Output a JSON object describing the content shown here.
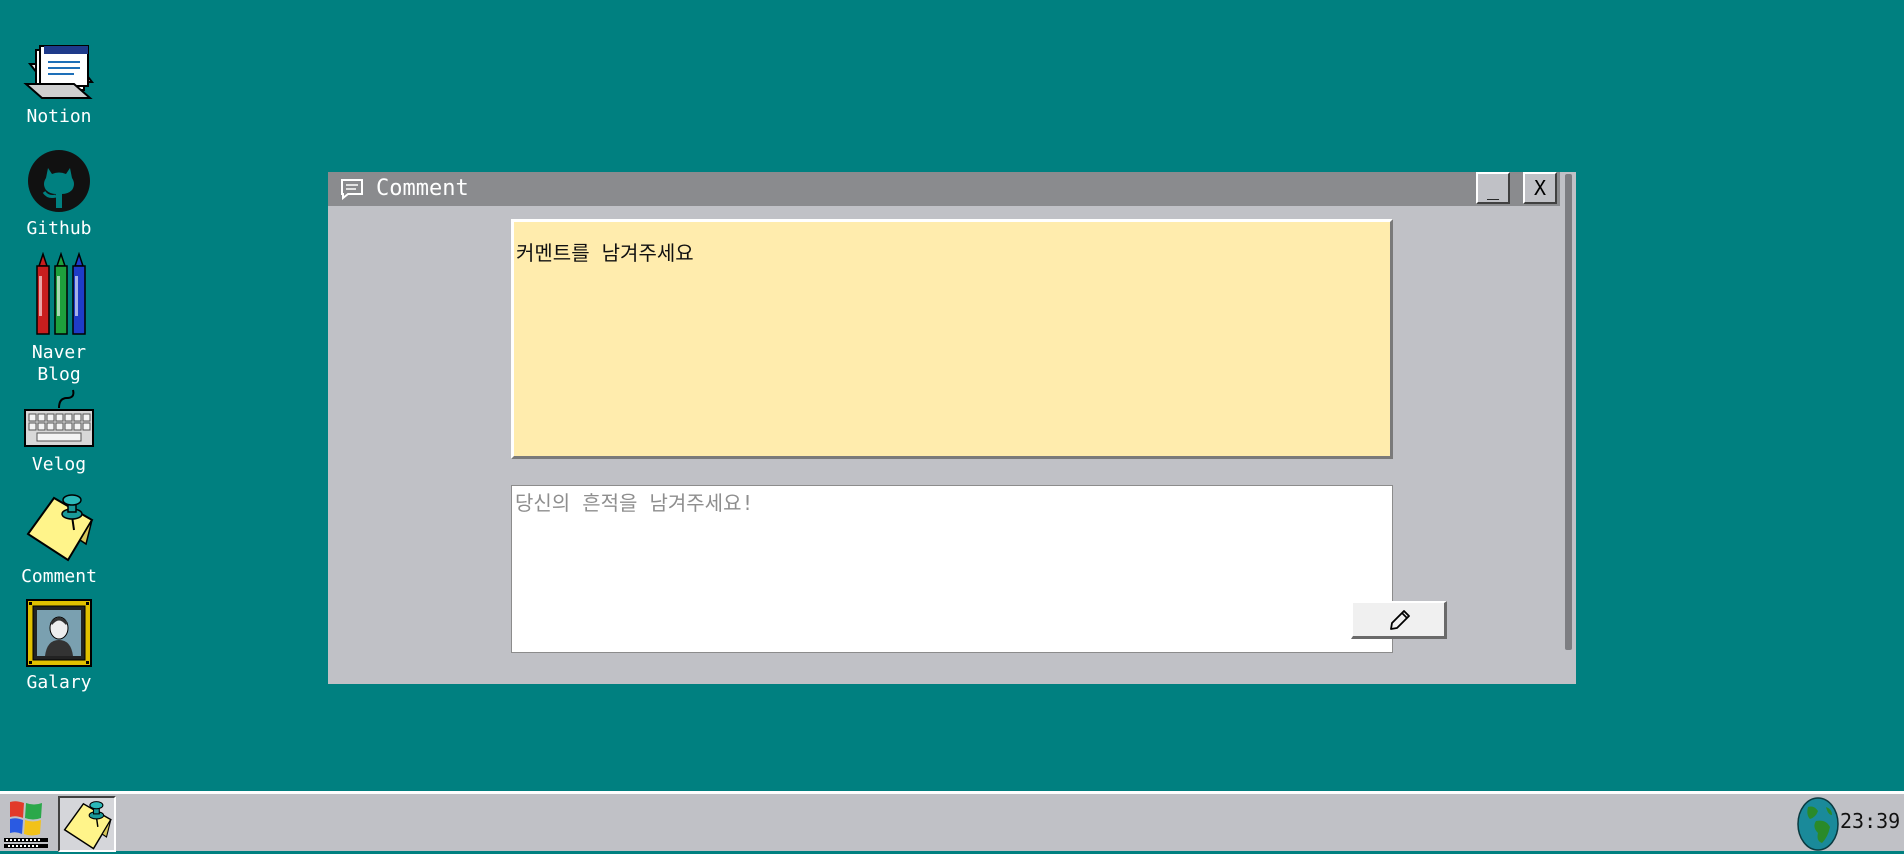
{
  "desktop": {
    "icons": [
      {
        "label": "Notion",
        "icon": "notion-icon"
      },
      {
        "label": "Github",
        "icon": "github-icon"
      },
      {
        "label": "Naver Blog",
        "icon": "crayons-icon"
      },
      {
        "label": "Velog",
        "icon": "keyboard-icon"
      },
      {
        "label": "Comment",
        "icon": "sticky-note-icon"
      },
      {
        "label": "Galary",
        "icon": "portrait-frame-icon"
      }
    ]
  },
  "window": {
    "title": "Comment",
    "title_icon": "comment-icon",
    "minimize_label": "_",
    "close_label": "X",
    "comment_display_text": "커멘트를 남겨주세요",
    "input_placeholder": "당신의 흔적을 남겨주세요!",
    "input_value": "",
    "submit_icon": "pencil-icon"
  },
  "taskbar": {
    "start_icon": "windows-logo-icon",
    "active_task_icon": "sticky-note-icon",
    "tray_icon": "globe-icon",
    "clock": "23:39"
  },
  "colors": {
    "desktop_bg": "#008080",
    "window_bg": "#c0c1c6",
    "titlebar_bg": "#8a8b8e",
    "comment_bg": "#ffecad"
  }
}
